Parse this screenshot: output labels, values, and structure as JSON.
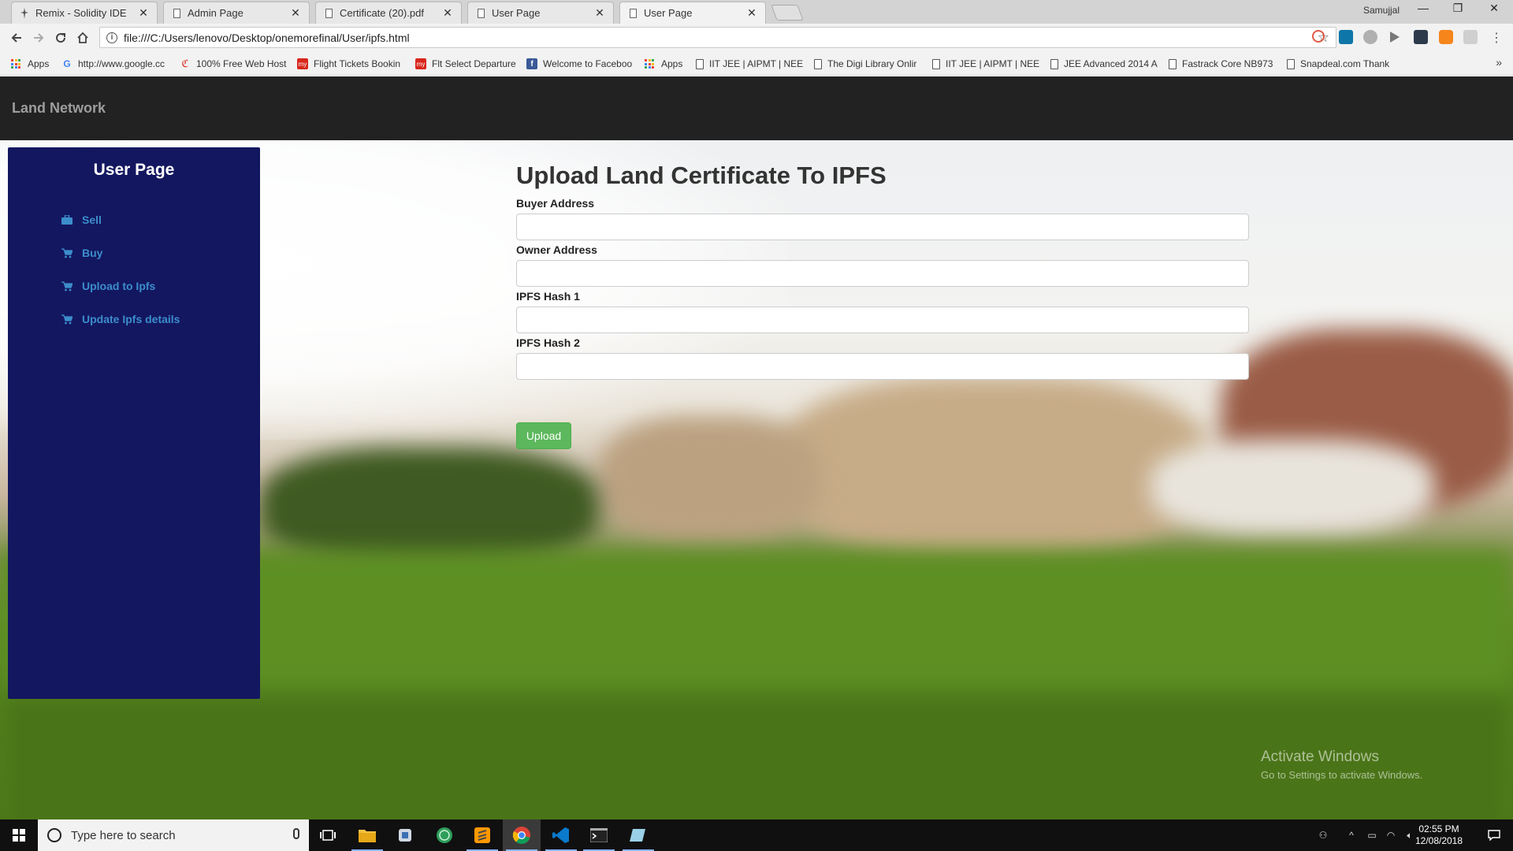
{
  "browser": {
    "tabs": [
      {
        "title": "Remix - Solidity IDE",
        "icon": "remix-icon"
      },
      {
        "title": "Admin Page",
        "icon": "page-icon"
      },
      {
        "title": "Certificate (20).pdf",
        "icon": "page-icon"
      },
      {
        "title": "User Page",
        "icon": "page-icon"
      },
      {
        "title": "User Page",
        "icon": "page-icon",
        "active": true
      }
    ],
    "close_glyph": "✕",
    "profile_name": "Samujjal",
    "url": "file:///C:/Users/lenovo/Desktop/onemorefinal/User/ipfs.html",
    "bookmarks": [
      {
        "label": "Apps",
        "icon": "apps-icon"
      },
      {
        "label": "http://www.google.cc",
        "icon": "google-icon"
      },
      {
        "label": "100% Free Web Host",
        "icon": "webhost-icon"
      },
      {
        "label": "Flight Tickets Bookin",
        "icon": "mmt-icon"
      },
      {
        "label": "Flt Select Departure",
        "icon": "mmt-icon"
      },
      {
        "label": "Welcome to Faceboo",
        "icon": "facebook-icon"
      },
      {
        "label": "Apps",
        "icon": "apps-icon"
      },
      {
        "label": "IIT JEE | AIPMT | NEET",
        "icon": "page-icon"
      },
      {
        "label": "The Digi Library Onlir",
        "icon": "page-icon"
      },
      {
        "label": "IIT JEE | AIPMT | NEET",
        "icon": "page-icon"
      },
      {
        "label": "JEE Advanced 2014 A",
        "icon": "page-icon"
      },
      {
        "label": "Fastrack Core NB973",
        "icon": "page-icon"
      },
      {
        "label": "Snapdeal.com Thank",
        "icon": "page-icon"
      }
    ],
    "more_bookmarks_glyph": "»"
  },
  "page": {
    "brand": "Land Network",
    "sidebar": {
      "title": "User Page",
      "items": [
        {
          "label": "Sell",
          "icon": "briefcase-icon"
        },
        {
          "label": "Buy",
          "icon": "cart-icon"
        },
        {
          "label": "Upload to Ipfs",
          "icon": "cart-icon"
        },
        {
          "label": "Update Ipfs details",
          "icon": "cart-icon"
        }
      ]
    },
    "form": {
      "title": "Upload Land Certificate To IPFS",
      "fields": [
        {
          "label": "Buyer Address",
          "value": ""
        },
        {
          "label": "Owner Address",
          "value": ""
        },
        {
          "label": "IPFS Hash 1",
          "value": ""
        },
        {
          "label": "IPFS Hash 2",
          "value": ""
        }
      ],
      "submit_label": "Upload",
      "submit_color": "#5cb85c"
    },
    "colors": {
      "navbar": "#222222",
      "sidebar": "#131760",
      "sidebar_link": "#3c8dcb"
    }
  },
  "watermark": {
    "line1": "Activate Windows",
    "line2": "Go to Settings to activate Windows."
  },
  "taskbar": {
    "search_placeholder": "Type here to search",
    "time": "02:55 PM",
    "date": "12/08/2018"
  }
}
